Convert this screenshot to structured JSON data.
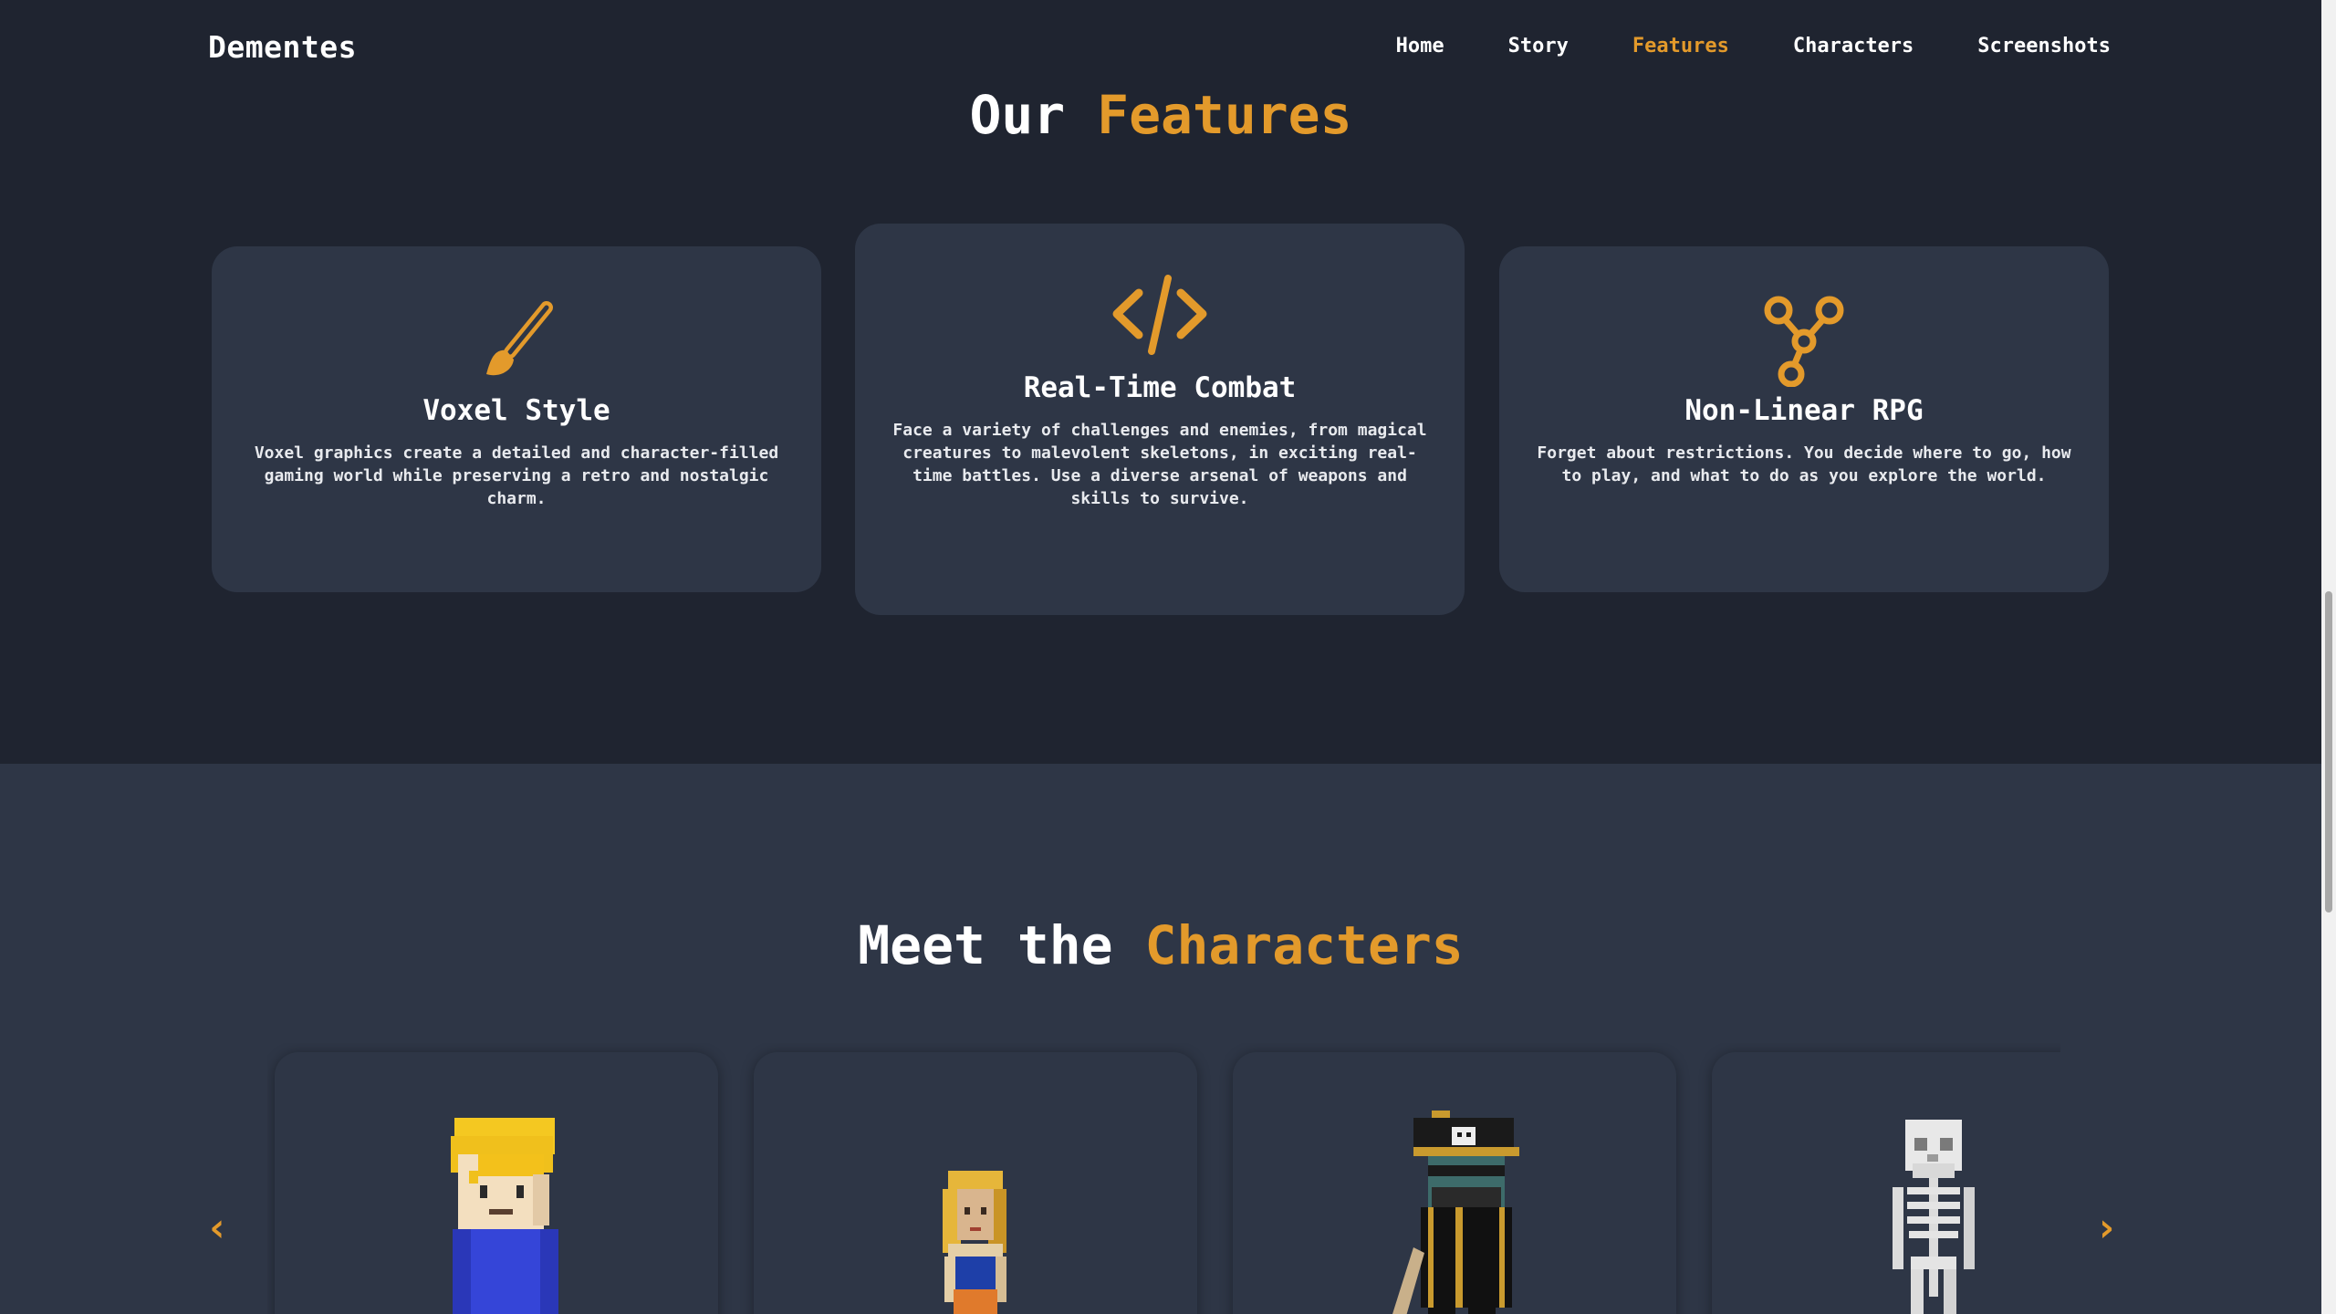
{
  "nav": {
    "brand": "Dementes",
    "links": [
      {
        "label": "Home"
      },
      {
        "label": "Story"
      },
      {
        "label": "Features"
      },
      {
        "label": "Characters"
      },
      {
        "label": "Screenshots"
      }
    ],
    "active": "Features"
  },
  "features": {
    "title_plain": "Our",
    "title_accent": "Features",
    "cards": [
      {
        "icon": "paintbrush-icon",
        "title": "Voxel Style",
        "description": "Voxel graphics create a detailed and character-filled gaming world while preserving a retro and nostalgic charm."
      },
      {
        "icon": "code-icon",
        "title": "Real-Time Combat",
        "description": "Face a variety of challenges and enemies, from magical creatures to malevolent skeletons, in exciting real-time battles. Use a diverse arsenal of weapons and skills to survive."
      },
      {
        "icon": "branches-icon",
        "title": "Non-Linear RPG",
        "description": "Forget about restrictions. You decide where to go, how to play, and what to do as you explore the world."
      }
    ]
  },
  "characters": {
    "title_plain": "Meet the",
    "title_accent": "Characters",
    "prev_label": "‹",
    "next_label": "›",
    "cards": [
      {
        "figure": "blonde-boy-voxel-figure"
      },
      {
        "figure": "blonde-girl-voxel-figure"
      },
      {
        "figure": "pirate-captain-voxel-figure"
      },
      {
        "figure": "skeleton-voxel-figure"
      }
    ]
  },
  "colors": {
    "accent": "#e39a2b",
    "background_dark": "#1f2430",
    "card_background": "#2e3646",
    "text": "#ffffff"
  }
}
